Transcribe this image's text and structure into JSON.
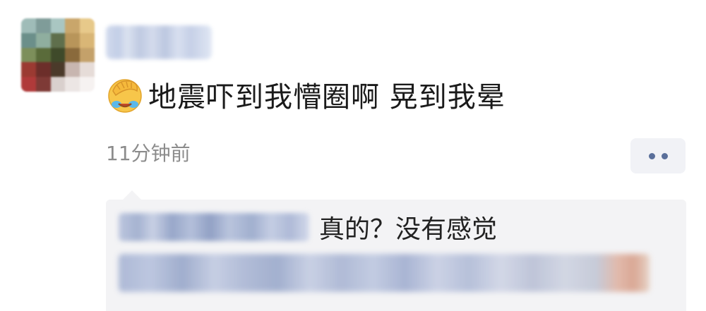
{
  "post": {
    "emoji_icon": "face-palm-crying-emoji",
    "text": "地震吓到我懵圈啊 晃到我晕",
    "timestamp": "11分钟前"
  },
  "actions": {
    "more_icon": "more-dots-icon"
  },
  "comments": [
    {
      "text": "真的？没有感觉"
    }
  ],
  "colors": {
    "text_primary": "#1a1a1a",
    "text_secondary": "#8c8c8c",
    "comment_bg": "#f3f3f5",
    "more_button_bg": "#f1f2f6",
    "accent_dots": "#5a6f9a"
  }
}
